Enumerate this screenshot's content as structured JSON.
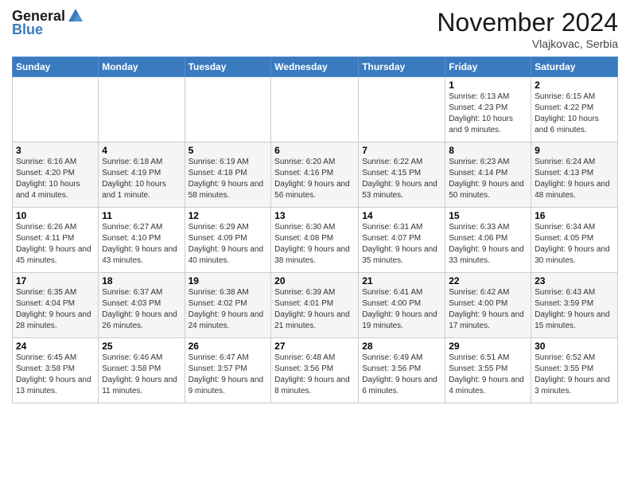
{
  "header": {
    "logo_general": "General",
    "logo_blue": "Blue",
    "month": "November 2024",
    "location": "Vlajkovac, Serbia"
  },
  "weekdays": [
    "Sunday",
    "Monday",
    "Tuesday",
    "Wednesday",
    "Thursday",
    "Friday",
    "Saturday"
  ],
  "weeks": [
    [
      {
        "day": "",
        "info": ""
      },
      {
        "day": "",
        "info": ""
      },
      {
        "day": "",
        "info": ""
      },
      {
        "day": "",
        "info": ""
      },
      {
        "day": "",
        "info": ""
      },
      {
        "day": "1",
        "info": "Sunrise: 6:13 AM\nSunset: 4:23 PM\nDaylight: 10 hours and 9 minutes."
      },
      {
        "day": "2",
        "info": "Sunrise: 6:15 AM\nSunset: 4:22 PM\nDaylight: 10 hours and 6 minutes."
      }
    ],
    [
      {
        "day": "3",
        "info": "Sunrise: 6:16 AM\nSunset: 4:20 PM\nDaylight: 10 hours and 4 minutes."
      },
      {
        "day": "4",
        "info": "Sunrise: 6:18 AM\nSunset: 4:19 PM\nDaylight: 10 hours and 1 minute."
      },
      {
        "day": "5",
        "info": "Sunrise: 6:19 AM\nSunset: 4:18 PM\nDaylight: 9 hours and 58 minutes."
      },
      {
        "day": "6",
        "info": "Sunrise: 6:20 AM\nSunset: 4:16 PM\nDaylight: 9 hours and 56 minutes."
      },
      {
        "day": "7",
        "info": "Sunrise: 6:22 AM\nSunset: 4:15 PM\nDaylight: 9 hours and 53 minutes."
      },
      {
        "day": "8",
        "info": "Sunrise: 6:23 AM\nSunset: 4:14 PM\nDaylight: 9 hours and 50 minutes."
      },
      {
        "day": "9",
        "info": "Sunrise: 6:24 AM\nSunset: 4:13 PM\nDaylight: 9 hours and 48 minutes."
      }
    ],
    [
      {
        "day": "10",
        "info": "Sunrise: 6:26 AM\nSunset: 4:11 PM\nDaylight: 9 hours and 45 minutes."
      },
      {
        "day": "11",
        "info": "Sunrise: 6:27 AM\nSunset: 4:10 PM\nDaylight: 9 hours and 43 minutes."
      },
      {
        "day": "12",
        "info": "Sunrise: 6:29 AM\nSunset: 4:09 PM\nDaylight: 9 hours and 40 minutes."
      },
      {
        "day": "13",
        "info": "Sunrise: 6:30 AM\nSunset: 4:08 PM\nDaylight: 9 hours and 38 minutes."
      },
      {
        "day": "14",
        "info": "Sunrise: 6:31 AM\nSunset: 4:07 PM\nDaylight: 9 hours and 35 minutes."
      },
      {
        "day": "15",
        "info": "Sunrise: 6:33 AM\nSunset: 4:06 PM\nDaylight: 9 hours and 33 minutes."
      },
      {
        "day": "16",
        "info": "Sunrise: 6:34 AM\nSunset: 4:05 PM\nDaylight: 9 hours and 30 minutes."
      }
    ],
    [
      {
        "day": "17",
        "info": "Sunrise: 6:35 AM\nSunset: 4:04 PM\nDaylight: 9 hours and 28 minutes."
      },
      {
        "day": "18",
        "info": "Sunrise: 6:37 AM\nSunset: 4:03 PM\nDaylight: 9 hours and 26 minutes."
      },
      {
        "day": "19",
        "info": "Sunrise: 6:38 AM\nSunset: 4:02 PM\nDaylight: 9 hours and 24 minutes."
      },
      {
        "day": "20",
        "info": "Sunrise: 6:39 AM\nSunset: 4:01 PM\nDaylight: 9 hours and 21 minutes."
      },
      {
        "day": "21",
        "info": "Sunrise: 6:41 AM\nSunset: 4:00 PM\nDaylight: 9 hours and 19 minutes."
      },
      {
        "day": "22",
        "info": "Sunrise: 6:42 AM\nSunset: 4:00 PM\nDaylight: 9 hours and 17 minutes."
      },
      {
        "day": "23",
        "info": "Sunrise: 6:43 AM\nSunset: 3:59 PM\nDaylight: 9 hours and 15 minutes."
      }
    ],
    [
      {
        "day": "24",
        "info": "Sunrise: 6:45 AM\nSunset: 3:58 PM\nDaylight: 9 hours and 13 minutes."
      },
      {
        "day": "25",
        "info": "Sunrise: 6:46 AM\nSunset: 3:58 PM\nDaylight: 9 hours and 11 minutes."
      },
      {
        "day": "26",
        "info": "Sunrise: 6:47 AM\nSunset: 3:57 PM\nDaylight: 9 hours and 9 minutes."
      },
      {
        "day": "27",
        "info": "Sunrise: 6:48 AM\nSunset: 3:56 PM\nDaylight: 9 hours and 8 minutes."
      },
      {
        "day": "28",
        "info": "Sunrise: 6:49 AM\nSunset: 3:56 PM\nDaylight: 9 hours and 6 minutes."
      },
      {
        "day": "29",
        "info": "Sunrise: 6:51 AM\nSunset: 3:55 PM\nDaylight: 9 hours and 4 minutes."
      },
      {
        "day": "30",
        "info": "Sunrise: 6:52 AM\nSunset: 3:55 PM\nDaylight: 9 hours and 3 minutes."
      }
    ]
  ]
}
